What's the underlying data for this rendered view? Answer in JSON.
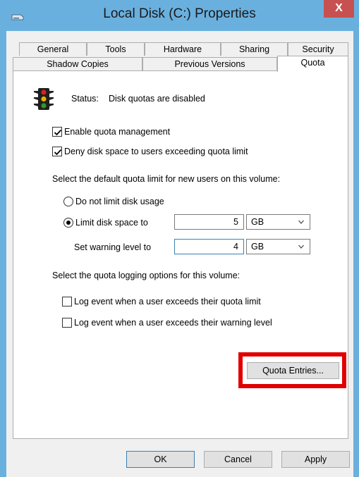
{
  "window": {
    "title": "Local Disk (C:) Properties",
    "close_glyph": "X"
  },
  "tabs_row1": [
    "General",
    "Tools",
    "Hardware",
    "Sharing",
    "Security"
  ],
  "tabs_row2": [
    "Shadow Copies",
    "Previous Versions",
    "Quota"
  ],
  "active_tab": "Quota",
  "status": {
    "label": "Status:",
    "text": "Disk quotas are disabled",
    "icon": "traffic-light-icon"
  },
  "enable_quota": {
    "label": "Enable quota management",
    "checked": true
  },
  "deny_space": {
    "label": "Deny disk space to users exceeding quota limit",
    "checked": true
  },
  "default_limit_heading": "Select the default quota limit for new users on this volume:",
  "no_limit": {
    "label": "Do not limit disk usage",
    "selected": false
  },
  "limit_space": {
    "label": "Limit disk space to",
    "selected": true,
    "value": "5",
    "unit": "GB"
  },
  "warning_level": {
    "label": "Set warning level to",
    "value": "4",
    "unit": "GB"
  },
  "logging_heading": "Select the quota logging options for this volume:",
  "log_quota": {
    "label": "Log event when a user exceeds their quota limit",
    "checked": false
  },
  "log_warning": {
    "label": "Log event when a user exceeds their warning level",
    "checked": false
  },
  "quota_entries_button": "Quota Entries...",
  "highlight_color": "#e00000",
  "footer": {
    "ok": "OK",
    "cancel": "Cancel",
    "apply": "Apply"
  }
}
